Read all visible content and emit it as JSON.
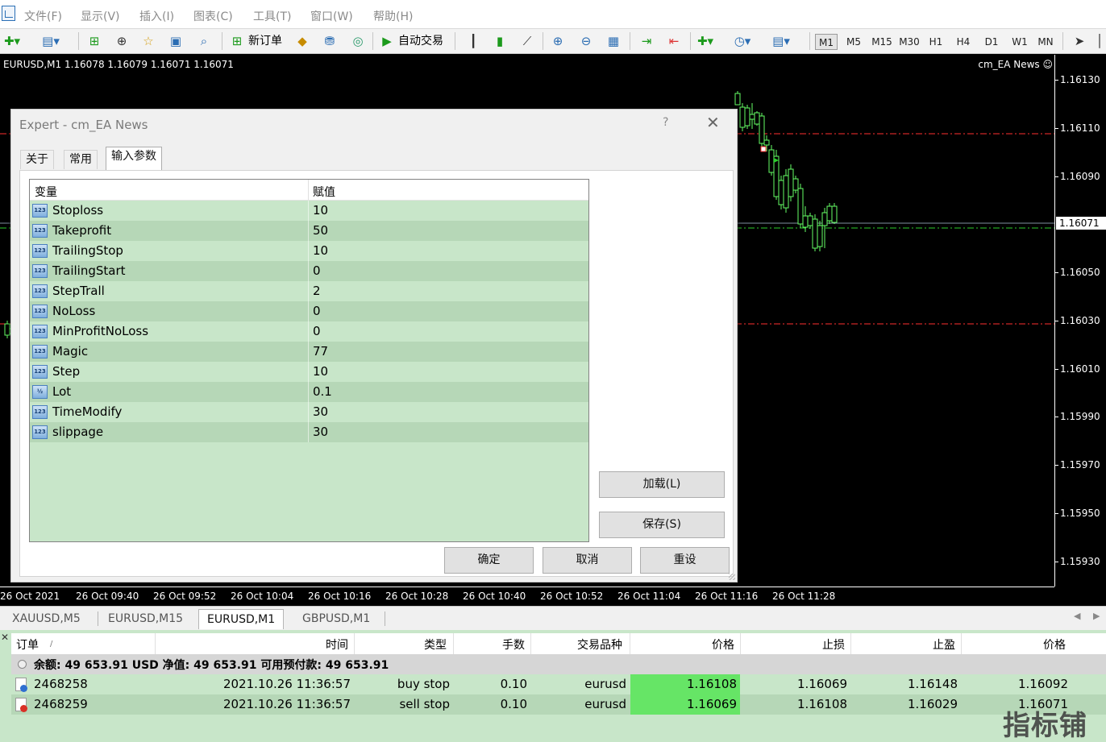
{
  "menu": [
    "文件(F)",
    "显示(V)",
    "插入(I)",
    "图表(C)",
    "工具(T)",
    "窗口(W)",
    "帮助(H)"
  ],
  "toolbar": {
    "new_order_label": "新订单",
    "auto_trading_label": "自动交易",
    "timeframes": [
      "M1",
      "M5",
      "M15",
      "M30",
      "H1",
      "H4",
      "D1",
      "W1",
      "MN"
    ],
    "active_timeframe": "M1"
  },
  "chart": {
    "title": "EURUSD,M1  1.16078 1.16079 1.16071 1.16071",
    "ea_label": "cm_EA News ☺",
    "price_ticks": [
      "1.16130",
      "1.16110",
      "1.16090",
      "1.16071",
      "1.16050",
      "1.16030",
      "1.16010",
      "1.15990",
      "1.15970",
      "1.15950",
      "1.15930"
    ],
    "current_price": "1.16071",
    "time_ticks": [
      "26 Oct 2021",
      "26 Oct 09:40",
      "26 Oct 09:52",
      "26 Oct 10:04",
      "26 Oct 10:16",
      "26 Oct 10:28",
      "26 Oct 10:40",
      "26 Oct 10:52",
      "26 Oct 11:04",
      "26 Oct 11:16",
      "26 Oct 11:28"
    ]
  },
  "dialog": {
    "title": "Expert - cm_EA News",
    "help": "?",
    "close": "✕",
    "tabs": [
      "关于",
      "常用",
      "输入参数"
    ],
    "active_tab": "输入参数",
    "columns": [
      "变量",
      "赋值"
    ],
    "params": [
      {
        "type": "123",
        "name": "Stoploss",
        "value": "10"
      },
      {
        "type": "123",
        "name": "Takeprofit",
        "value": "50"
      },
      {
        "type": "123",
        "name": "TrailingStop",
        "value": "10"
      },
      {
        "type": "123",
        "name": "TrailingStart",
        "value": "0"
      },
      {
        "type": "123",
        "name": "StepTrall",
        "value": "2"
      },
      {
        "type": "123",
        "name": "NoLoss",
        "value": "0"
      },
      {
        "type": "123",
        "name": "MinProfitNoLoss",
        "value": "0"
      },
      {
        "type": "123",
        "name": "Magic",
        "value": "77"
      },
      {
        "type": "123",
        "name": "Step",
        "value": "10"
      },
      {
        "type": "½",
        "name": "Lot",
        "value": "0.1"
      },
      {
        "type": "123",
        "name": "TimeModify",
        "value": "30"
      },
      {
        "type": "123",
        "name": "slippage",
        "value": "30"
      }
    ],
    "load_label": "加载(L)",
    "save_label": "保存(S)",
    "ok_label": "确定",
    "cancel_label": "取消",
    "reset_label": "重设"
  },
  "chart_tabs": [
    "XAUUSD,M5",
    "EURUSD,M15",
    "EURUSD,M1",
    "GBPUSD,M1"
  ],
  "active_chart_tab": "EURUSD,M1",
  "terminal": {
    "close": "✕",
    "columns": [
      "订单",
      "/",
      "时间",
      "类型",
      "手数",
      "交易品种",
      "价格",
      "止损",
      "止盈",
      "价格"
    ],
    "balance": "余额: 49 653.91 USD  净值: 49 653.91  可用预付款: 49 653.91",
    "orders": [
      {
        "id": "2468258",
        "time": "2021.10.26 11:36:57",
        "type": "buy stop",
        "lots": "0.10",
        "symbol": "eurusd",
        "price": "1.16108",
        "sl": "1.16069",
        "tp": "1.16148",
        "current": "1.16092",
        "status_color": "#2f6fd0"
      },
      {
        "id": "2468259",
        "time": "2021.10.26 11:36:57",
        "type": "sell stop",
        "lots": "0.10",
        "symbol": "eurusd",
        "price": "1.16069",
        "sl": "1.16108",
        "tp": "1.16029",
        "current": "1.16071",
        "status_color": "#d93025"
      }
    ]
  },
  "watermark": "指标铺",
  "colors": {
    "bull": "#66ff66",
    "bear": "#000000",
    "stop_line": "#ff3030",
    "order_line": "#2bd02b",
    "bid_line": "#7f8fa0",
    "grid_bg": "#c8e6c9",
    "highlight": "#66e566"
  }
}
